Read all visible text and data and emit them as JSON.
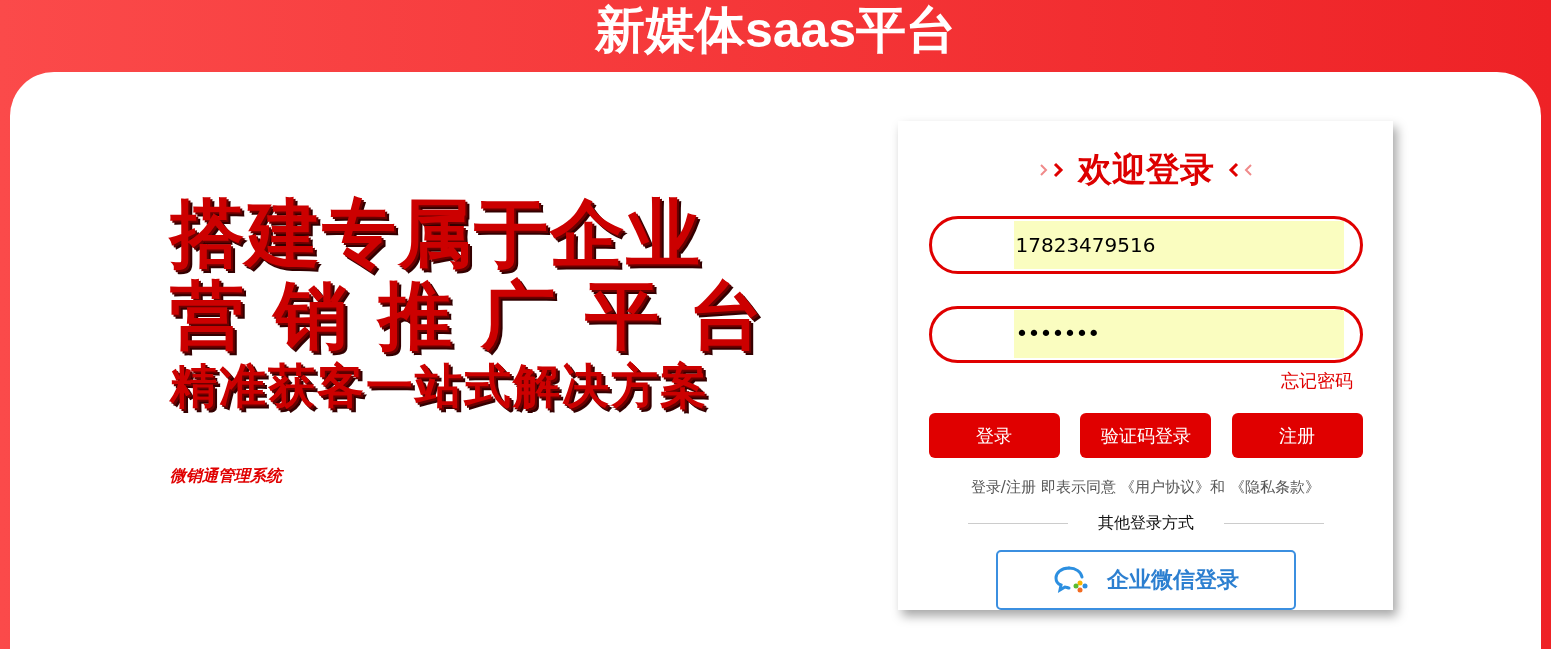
{
  "header": {
    "title": "新媒体saas平台"
  },
  "promo": {
    "lines": [
      "搭建专属于企业",
      "营 销 推 广 平 台",
      "精准获客一站式解决方案"
    ],
    "caption": "微销通管理系统"
  },
  "login": {
    "title": "欢迎登录",
    "fields": [
      {
        "kind": "text",
        "value": "17823479516",
        "autofilled": true
      },
      {
        "kind": "password",
        "value": "•••••••",
        "autofilled": true
      }
    ],
    "forgot": "忘记密码",
    "buttons": [
      "登录",
      "验证码登录",
      "注册"
    ],
    "agreement": {
      "text": "登录/注册 即表示同意",
      "links": [
        "《用户协议》",
        "《隐私条款》"
      ],
      "joiner": "和"
    },
    "other_label": "其他登录方式",
    "wecom_button": "企业微信登录"
  }
}
